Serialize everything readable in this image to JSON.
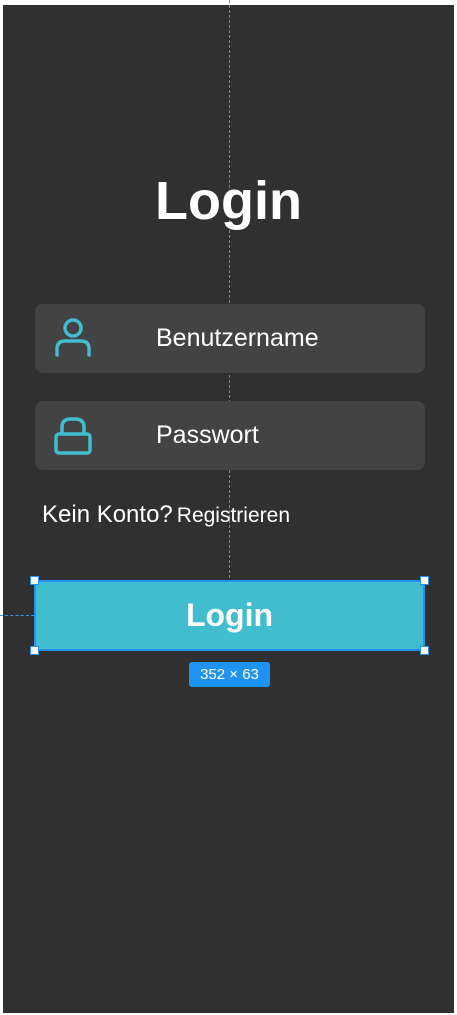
{
  "screen": {
    "title": "Login"
  },
  "form": {
    "username_placeholder": "Benutzername",
    "password_placeholder": "Passwort",
    "username_icon": "user-icon",
    "password_icon": "lock-icon"
  },
  "signup": {
    "prompt": "Kein Konto?",
    "link_label": "Registrieren"
  },
  "login_button": {
    "label": "Login"
  },
  "selection": {
    "size_label": "352 × 63"
  },
  "colors": {
    "background": "#313031",
    "field_background": "#444344",
    "accent": "#41bdd0",
    "selection_blue": "#1f93f2",
    "text": "#ffffff"
  }
}
